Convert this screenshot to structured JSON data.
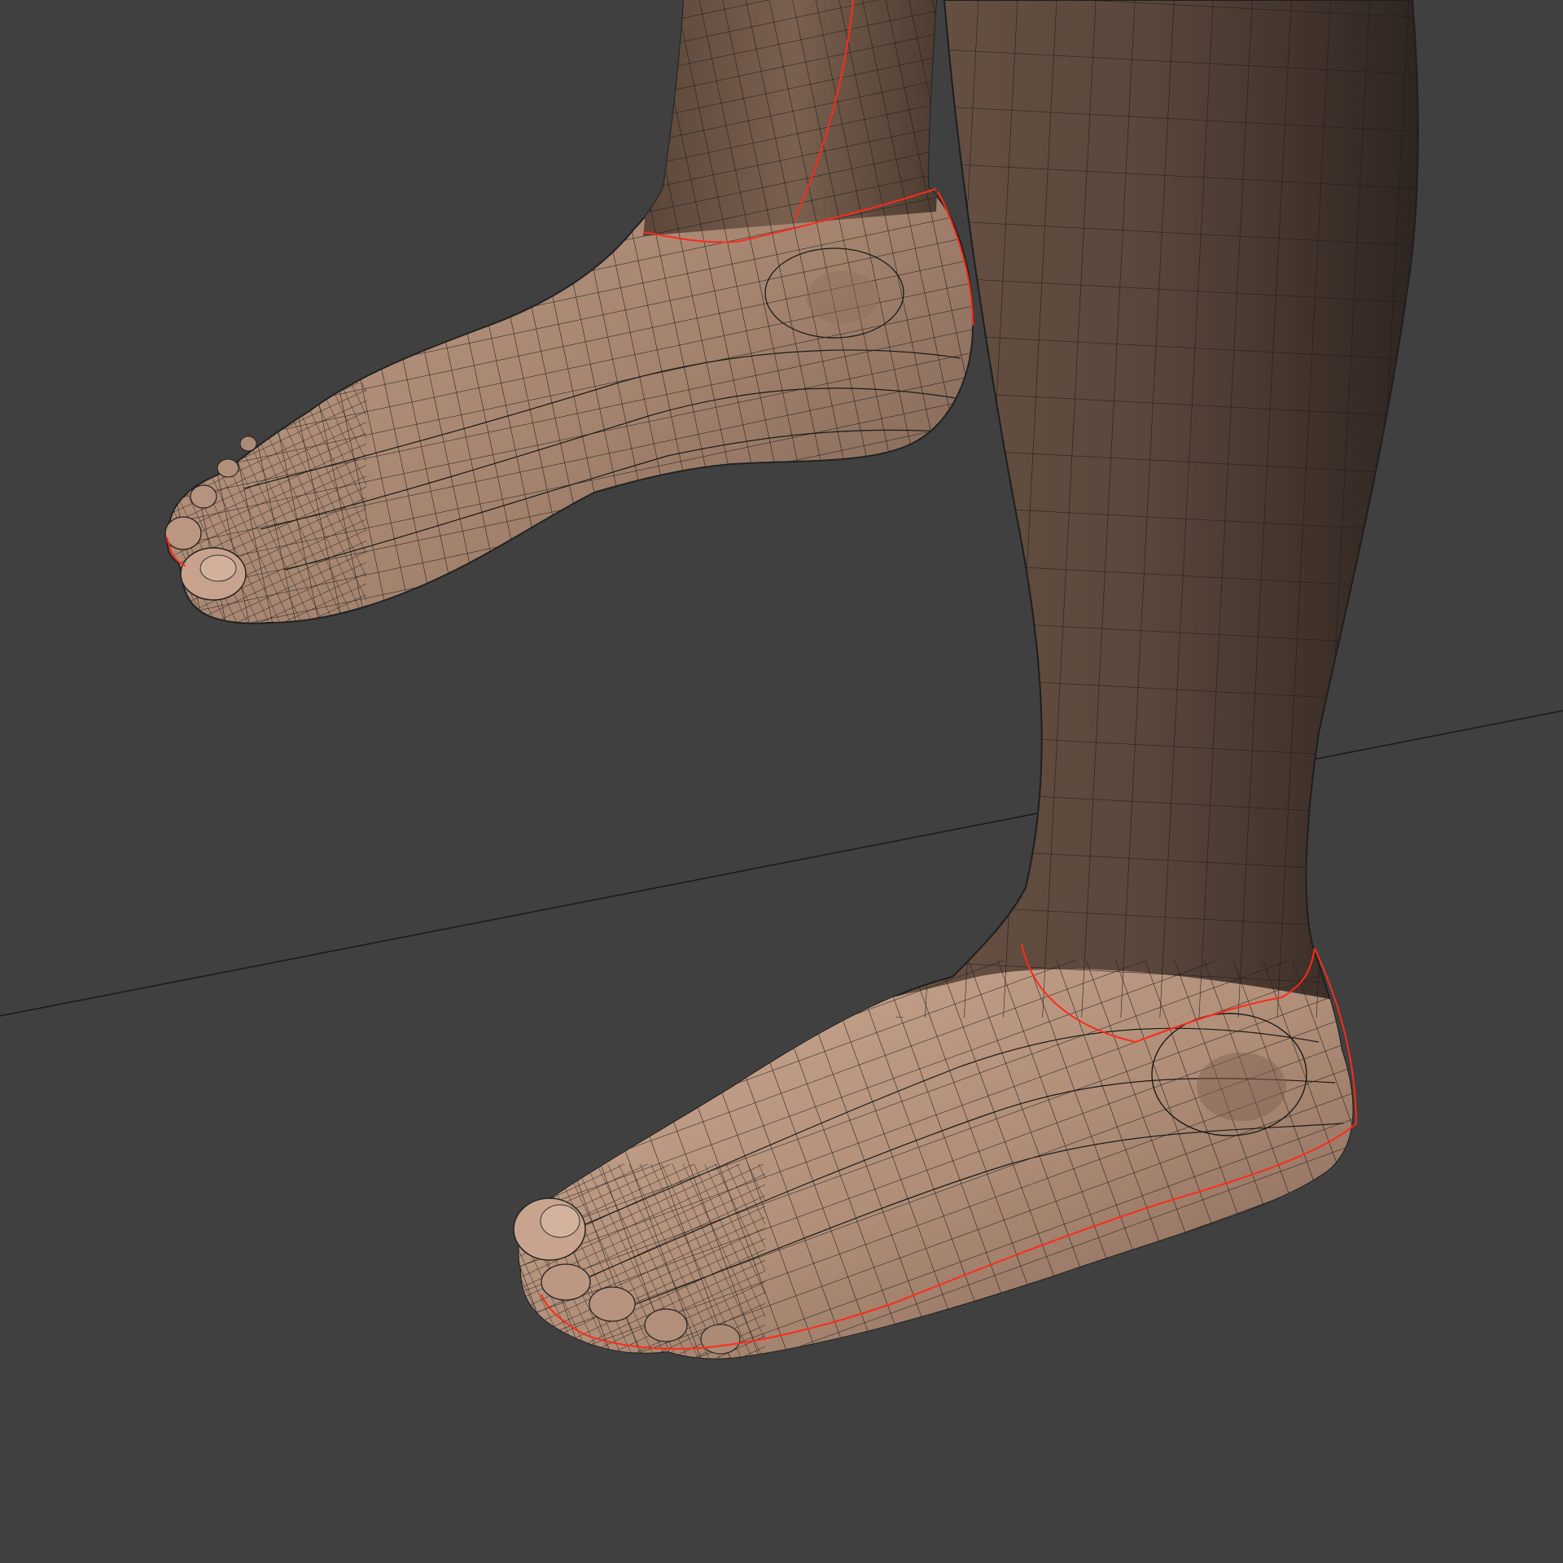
{
  "viewport": {
    "background_color": "#404040",
    "grid_line_color": "#1c1c1c",
    "wire_color": "#1a1a1a",
    "seam_color": "#ff2a1a",
    "skin_light": "#c9a690",
    "skin_mid": "#9e7e6a",
    "skin_dark": "#5e4a3f",
    "leg_dark": "#4f3d33"
  },
  "objects": {
    "left_foot": {
      "icon": "mesh-foot"
    },
    "right_leg": {
      "icon": "mesh-leg"
    },
    "floor_grid_line": {
      "icon": "grid-axis"
    }
  }
}
